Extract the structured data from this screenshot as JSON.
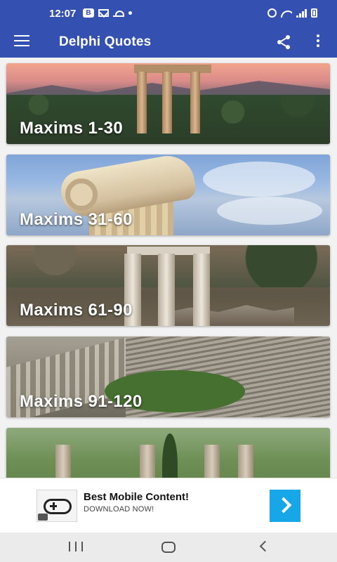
{
  "status_bar": {
    "time": "12:07",
    "left_icons": [
      "b-badge-icon",
      "mail-icon",
      "weather-icon",
      "notification-dot-icon"
    ],
    "right_icons": [
      "alarm-icon",
      "wifi-icon",
      "signal-icon",
      "battery-icon"
    ]
  },
  "app_bar": {
    "title": "Delphi Quotes",
    "color": "#3451b2",
    "icons": [
      "menu-icon",
      "share-icon",
      "more-vert-icon"
    ]
  },
  "cards": [
    {
      "label": "Maxims 1-30"
    },
    {
      "label": "Maxims 31-60"
    },
    {
      "label": "Maxims 61-90"
    },
    {
      "label": "Maxims 91-120"
    },
    {
      "label": ""
    }
  ],
  "ad": {
    "title": "Best Mobile Content!",
    "subtitle": "DOWNLOAD NOW!",
    "button_color": "#17a6e8",
    "icon": "gamepad-icon"
  },
  "nav_bar": {
    "icons": [
      "recent-apps-icon",
      "home-icon",
      "back-icon"
    ]
  }
}
